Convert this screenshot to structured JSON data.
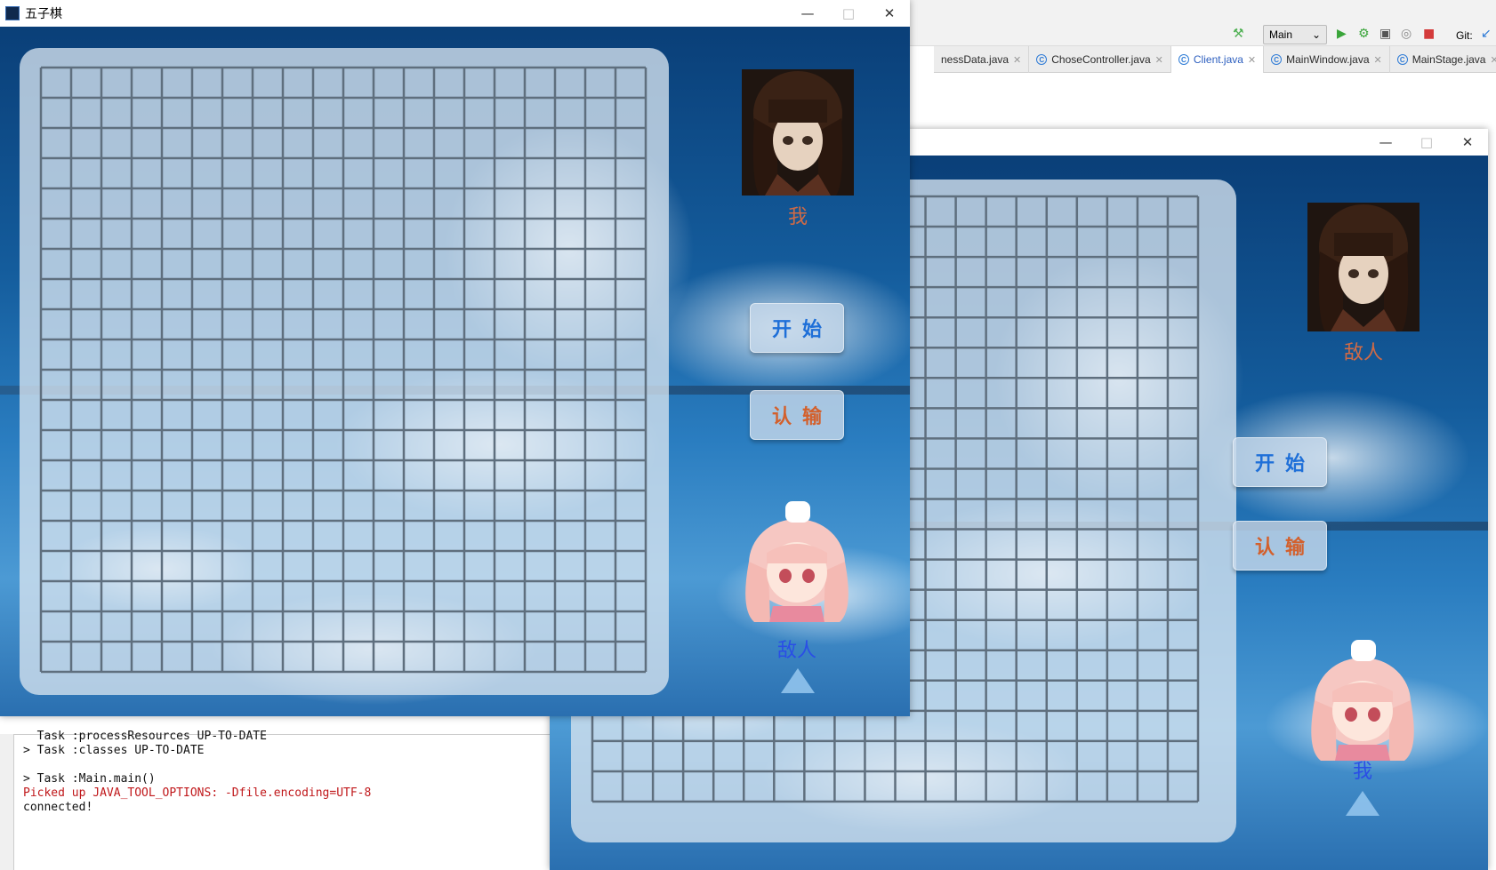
{
  "ide": {
    "run_config": "Main",
    "git_label": "Git:",
    "tabs": [
      {
        "label": "nessData.java",
        "active": false
      },
      {
        "label": "ChoseController.java",
        "active": false
      },
      {
        "label": "Client.java",
        "active": true
      },
      {
        "label": "MainWindow.java",
        "active": false
      },
      {
        "label": "MainStage.java",
        "active": false
      }
    ],
    "console_lines": [
      {
        "text": "  Task :processResources UP-TO-DATE",
        "color": "black"
      },
      {
        "text": "> Task :classes UP-TO-DATE",
        "color": "black"
      },
      {
        "text": "",
        "color": "black"
      },
      {
        "text": "> Task :Main.main()",
        "color": "black"
      },
      {
        "text": "Picked up JAVA_TOOL_OPTIONS: -Dfile.encoding=UTF-8",
        "color": "#c0181b"
      },
      {
        "text": "connected!",
        "color": "black"
      }
    ]
  },
  "window_front": {
    "title": "五子棋",
    "board": {
      "rows": 20,
      "cols": 20
    },
    "top_player_label": "我",
    "bottom_player_label": "敌人",
    "start_button": "开始",
    "surrender_button": "认输",
    "indicator": "up-triangle-icon"
  },
  "window_back": {
    "title": "",
    "board": {
      "rows": 20,
      "cols": 20
    },
    "top_player_label": "敌人",
    "bottom_player_label": "我",
    "start_button": "开始",
    "surrender_button": "认输",
    "indicator": "up-triangle-icon"
  },
  "colors": {
    "sky_dark": "#0a3f78",
    "board_line": "#5f6f7e",
    "start_text": "#1e6fd8",
    "surrender_text": "#d3602c",
    "label_warm": "#d06a45",
    "label_blue": "#2a4ee6"
  }
}
